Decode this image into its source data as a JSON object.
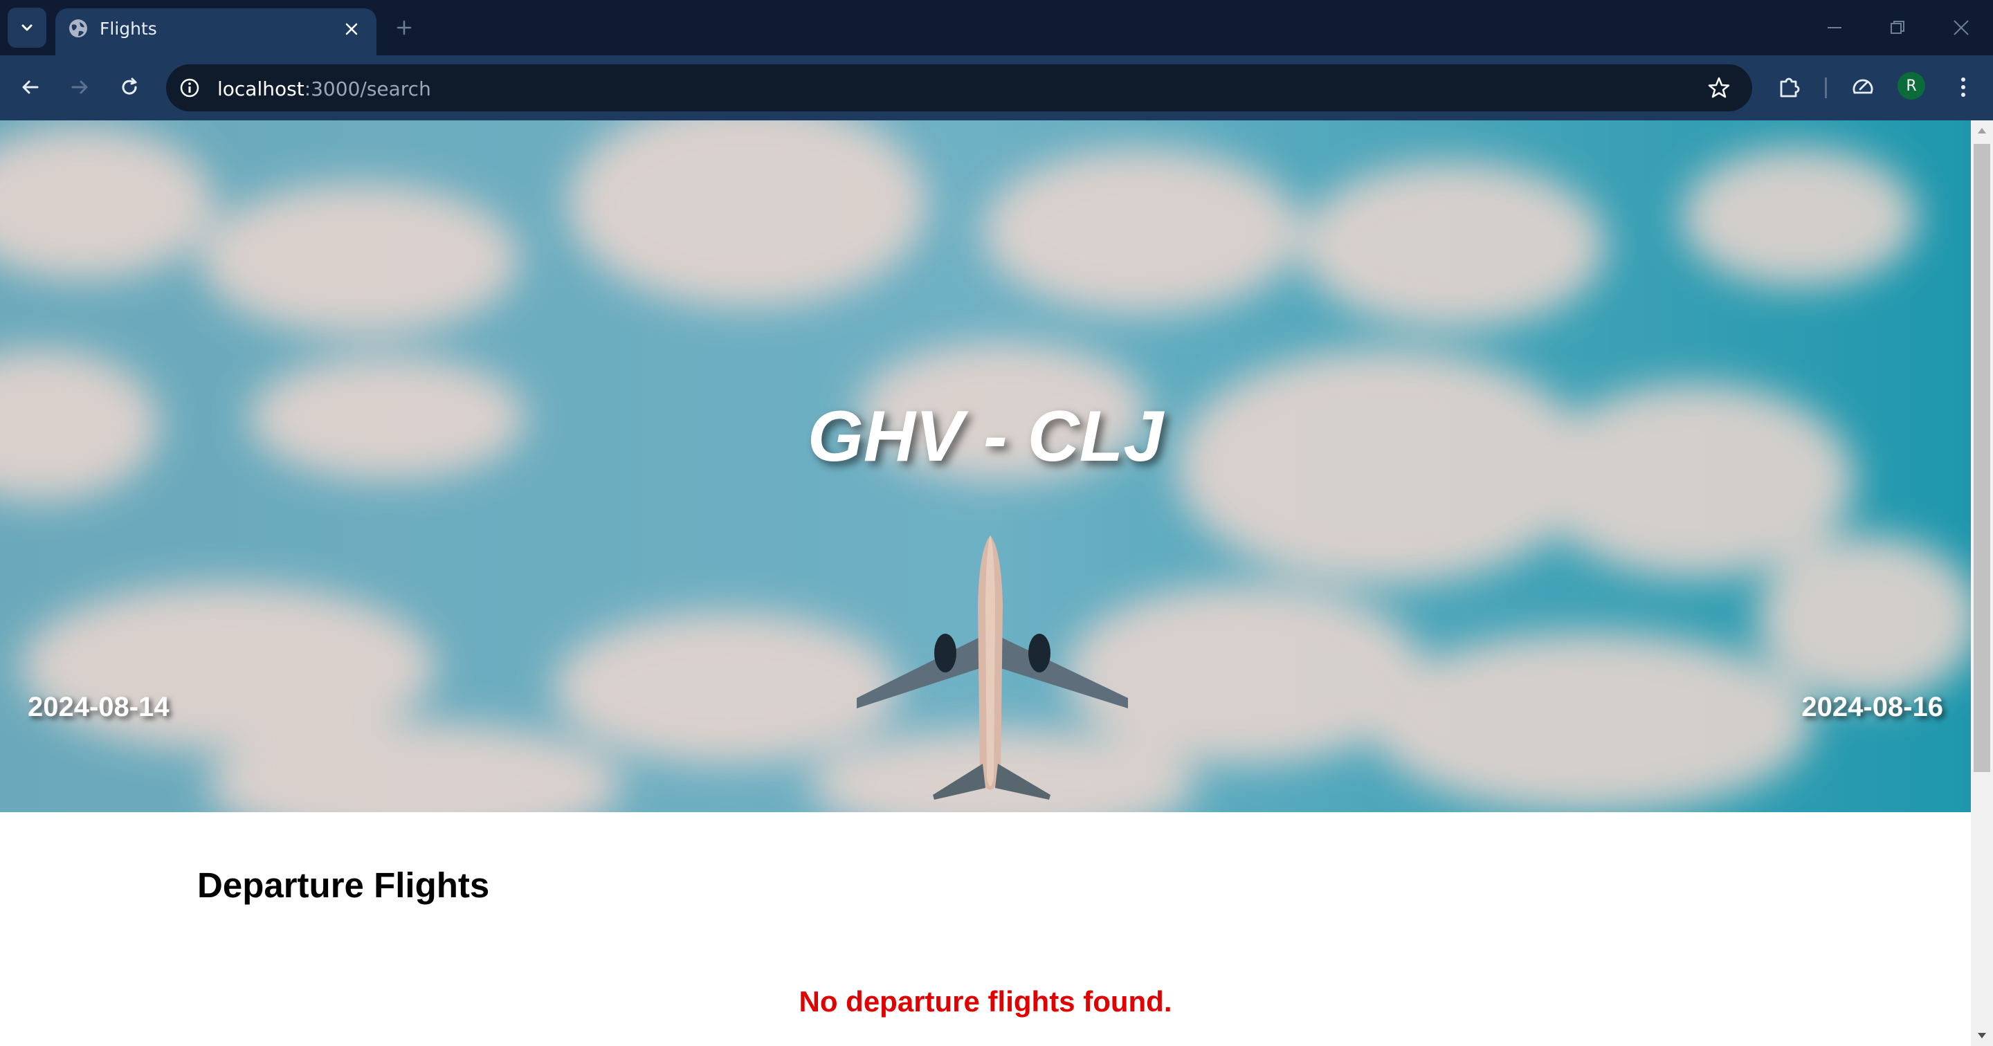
{
  "browser": {
    "tab": {
      "title": "Flights"
    },
    "address_bar": {
      "host": "localhost",
      "path": ":3000/search"
    },
    "profile_initial": "R"
  },
  "hero": {
    "route": "GHV - CLJ",
    "departure_date": "2024-08-14",
    "return_date": "2024-08-16"
  },
  "departures": {
    "heading": "Departure Flights",
    "empty_message": "No departure flights found."
  },
  "colors": {
    "chrome_dark": "#0e1b32",
    "chrome_toolbar": "#1e3a5f",
    "sky": "#5ea4b8",
    "error_text": "#e00000"
  }
}
